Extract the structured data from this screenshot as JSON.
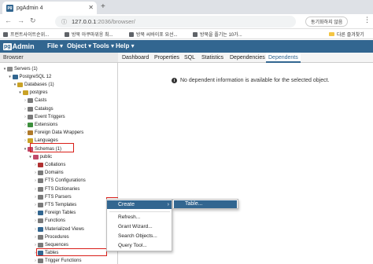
{
  "browser": {
    "tab_title": "pgAdmin 4",
    "url_host": "127.0.0.1",
    "url_rest": ":2036/browser/",
    "sync_button": "동기화하지 않음",
    "bookmarks": [
      "프런트사이트순위...",
      "방북 아쿠마위응 최...",
      "방북 씨바이포 요선...",
      "방북을 플기는 10가..."
    ],
    "other_bookmarks": "다른 즐겨찾기"
  },
  "pgadmin": {
    "logo_pg": "pg",
    "logo_admin": "Admin",
    "menu": [
      "File",
      "Object",
      "Tools",
      "Help"
    ]
  },
  "browser_panel": {
    "title": "Browser",
    "tree": [
      {
        "label": "Servers (1)",
        "depth": 0,
        "caret": "v",
        "icon_color": "#8a8a8a"
      },
      {
        "label": "PostgreSQL 12",
        "depth": 1,
        "caret": "v",
        "icon_color": "#326690"
      },
      {
        "label": "Databases (1)",
        "depth": 2,
        "caret": "v",
        "icon_color": "#c9a227"
      },
      {
        "label": "postgres",
        "depth": 3,
        "caret": "v",
        "icon_color": "#c9a227"
      },
      {
        "label": "Casts",
        "depth": 4,
        "caret": ">",
        "icon_color": "#7a7a7a"
      },
      {
        "label": "Catalogs",
        "depth": 4,
        "caret": ">",
        "icon_color": "#7a7a7a"
      },
      {
        "label": "Event Triggers",
        "depth": 4,
        "caret": ">",
        "icon_color": "#7a7a7a"
      },
      {
        "label": "Extensions",
        "depth": 4,
        "caret": ">",
        "icon_color": "#3d8f3d"
      },
      {
        "label": "Foreign Data Wrappers",
        "depth": 4,
        "caret": ">",
        "icon_color": "#b07a2a"
      },
      {
        "label": "Languages",
        "depth": 4,
        "caret": ">",
        "icon_color": "#c9a227"
      },
      {
        "label": "Schemas (1)",
        "depth": 4,
        "caret": "v",
        "icon_color": "#c14a6a"
      },
      {
        "label": "public",
        "depth": 5,
        "caret": "v",
        "icon_color": "#c14a6a"
      },
      {
        "label": "Collations",
        "depth": 6,
        "caret": ">",
        "icon_color": "#b03030"
      },
      {
        "label": "Domains",
        "depth": 6,
        "caret": ">",
        "icon_color": "#7a7a7a"
      },
      {
        "label": "FTS Configurations",
        "depth": 6,
        "caret": ">",
        "icon_color": "#7a7a7a"
      },
      {
        "label": "FTS Dictionaries",
        "depth": 6,
        "caret": ">",
        "icon_color": "#7a7a7a"
      },
      {
        "label": "FTS Parsers",
        "depth": 6,
        "caret": ">",
        "icon_color": "#7a7a7a"
      },
      {
        "label": "FTS Templates",
        "depth": 6,
        "caret": ">",
        "icon_color": "#7a7a7a"
      },
      {
        "label": "Foreign Tables",
        "depth": 6,
        "caret": ">",
        "icon_color": "#326690"
      },
      {
        "label": "Functions",
        "depth": 6,
        "caret": ">",
        "icon_color": "#7a7a7a"
      },
      {
        "label": "Materialized Views",
        "depth": 6,
        "caret": ">",
        "icon_color": "#326690"
      },
      {
        "label": "Procedures",
        "depth": 6,
        "caret": ">",
        "icon_color": "#7a7a7a"
      },
      {
        "label": "Sequences",
        "depth": 6,
        "caret": ">",
        "icon_color": "#7a7a7a"
      },
      {
        "label": "Tables",
        "depth": 6,
        "caret": ">",
        "icon_color": "#326690"
      },
      {
        "label": "Trigger Functions",
        "depth": 6,
        "caret": ">",
        "icon_color": "#7a7a7a"
      }
    ]
  },
  "main_panel": {
    "tabs": [
      "Dashboard",
      "Properties",
      "SQL",
      "Statistics",
      "Dependencies",
      "Dependents"
    ],
    "active_tab": "Dependents",
    "message": "No dependent information is available for the selected object."
  },
  "context_menu": {
    "create": "Create",
    "items": [
      "Refresh...",
      "Grant Wizard...",
      "Search Objects...",
      "Query Tool..."
    ],
    "submenu_item": "Table..."
  },
  "colors": {
    "pgadmin_blue": "#326690",
    "highlight_red": "#d91e18"
  }
}
